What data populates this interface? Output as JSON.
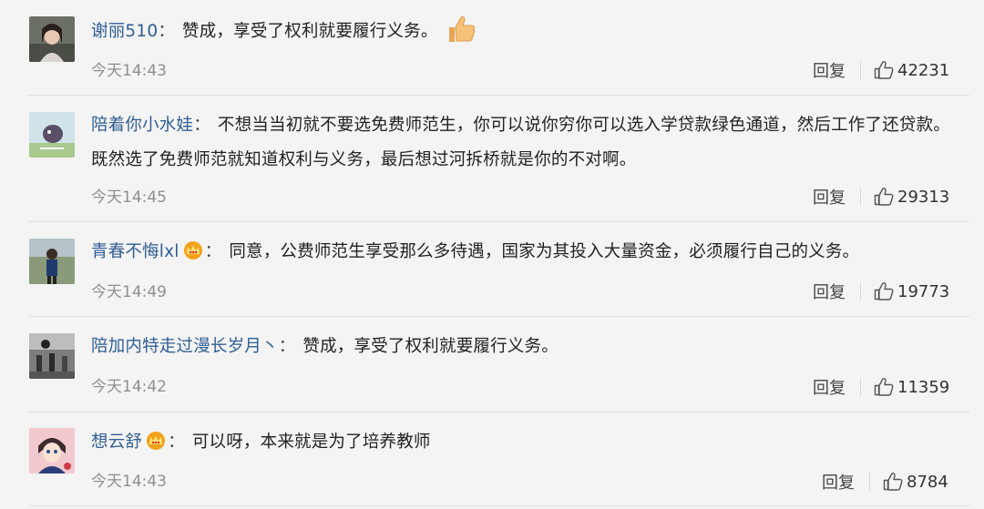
{
  "comments": [
    {
      "user": "谢丽510",
      "colon": "：",
      "text": "赞成，享受了权利就要履行义务。",
      "emoji": "thumbs-up",
      "time": "今天14:43",
      "reply": "回复",
      "likes": "42231"
    },
    {
      "user": "陪着你小水娃",
      "colon": "：",
      "text": "不想当当初就不要选免费师范生，你可以说你穷你可以选入学贷款绿色通道，然后工作了还贷款。既然选了免费师范就知道权利与义务，最后想过河拆桥就是你的不对啊。",
      "time": "今天14:45",
      "reply": "回复",
      "likes": "29313"
    },
    {
      "user": "青春不悔lxl",
      "colon": "：",
      "badge": "crown-icon",
      "text": "同意，公费师范生享受那么多待遇，国家为其投入大量资金，必须履行自己的义务。",
      "time": "今天14:49",
      "reply": "回复",
      "likes": "19773"
    },
    {
      "user": "陪加内特走过漫长岁月丶",
      "colon": "：",
      "text": "赞成，享受了权利就要履行义务。",
      "time": "今天14:42",
      "reply": "回复",
      "likes": "11359"
    },
    {
      "user": "想云舒",
      "colon": "：",
      "badge": "crown-icon",
      "text": "可以呀，本来就是为了培养教师",
      "time": "今天14:43",
      "reply": "回复",
      "likes": "8784"
    }
  ],
  "colors": {
    "username": "#2f5e95",
    "time": "#8f8f8f",
    "background": "#f4f4f4",
    "divider": "#dedede"
  }
}
